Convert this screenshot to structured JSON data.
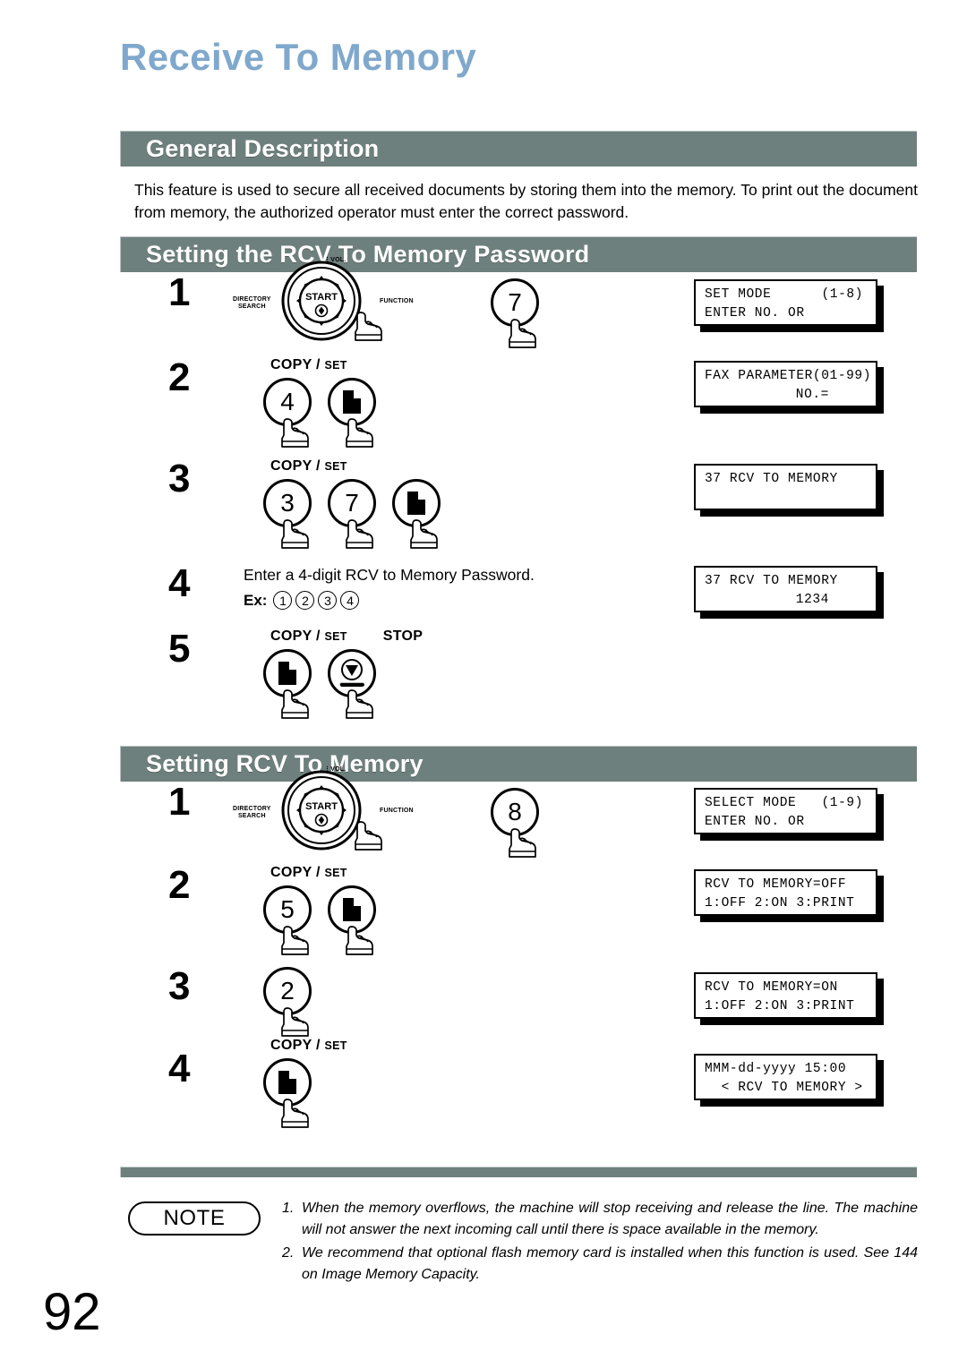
{
  "page": {
    "title": "Receive To Memory",
    "number": "92",
    "title_color": "#7fa8cc",
    "bar_color": "#6e807e"
  },
  "sections": {
    "general": {
      "heading": "General Description",
      "body": "This feature is used to secure all received documents by storing them into the memory.  To print out the document from memory, the authorized operator must enter the correct password."
    },
    "password": {
      "heading": "Setting the RCV To Memory Password",
      "steps": [
        {
          "num": "1",
          "type": "navwheel",
          "wheel": {
            "center": "START",
            "vol": "VOL.",
            "left": "DIRECTORY\nSEARCH",
            "right": "FUNCTION"
          },
          "keys": [
            {
              "label": "7",
              "glyph": "digit"
            }
          ],
          "lcd": {
            "line1": "SET MODE",
            "line1_right": "(1-8)",
            "line2": "ENTER NO. OR"
          }
        },
        {
          "num": "2",
          "type": "keys",
          "keylabel_main": "COPY /",
          "keylabel_sub": "SET",
          "keys": [
            {
              "label": "4",
              "glyph": "digit"
            },
            {
              "label": "",
              "glyph": "page"
            }
          ],
          "lcd": {
            "line1": "FAX PARAMETER(01-99)",
            "line2_right": "NO.="
          }
        },
        {
          "num": "3",
          "type": "keys",
          "keylabel_main": "COPY /",
          "keylabel_sub": "SET",
          "keys": [
            {
              "label": "3",
              "glyph": "digit"
            },
            {
              "label": "7",
              "glyph": "digit"
            },
            {
              "label": "",
              "glyph": "page"
            }
          ],
          "lcd": {
            "line1": "37 RCV TO MEMORY",
            "line2": ""
          }
        },
        {
          "num": "4",
          "type": "text",
          "text": "Enter a 4-digit RCV to Memory Password.",
          "example_label": "Ex:",
          "example_digits": [
            "1",
            "2",
            "3",
            "4"
          ],
          "lcd": {
            "line1": "37 RCV TO MEMORY",
            "line2_right": "1234"
          }
        },
        {
          "num": "5",
          "type": "keys",
          "keylabel_main": "COPY /",
          "keylabel_sub": "SET",
          "keylabel_second": "STOP",
          "keys": [
            {
              "label": "",
              "glyph": "page"
            },
            {
              "label": "",
              "glyph": "stop"
            }
          ],
          "lcd": null
        }
      ]
    },
    "setting": {
      "heading": "Setting RCV To Memory",
      "steps": [
        {
          "num": "1",
          "type": "navwheel",
          "wheel": {
            "center": "START",
            "vol": "VOL.",
            "left": "DIRECTORY\nSEARCH",
            "right": "FUNCTION"
          },
          "keys": [
            {
              "label": "8",
              "glyph": "digit"
            }
          ],
          "lcd": {
            "line1": "SELECT MODE",
            "line1_right": "(1-9)",
            "line2": "ENTER NO. OR"
          }
        },
        {
          "num": "2",
          "type": "keys",
          "keylabel_main": "COPY /",
          "keylabel_sub": "SET",
          "keys": [
            {
              "label": "5",
              "glyph": "digit"
            },
            {
              "label": "",
              "glyph": "page"
            }
          ],
          "lcd": {
            "line1": "RCV TO MEMORY=OFF",
            "line2": "1:OFF 2:ON 3:PRINT"
          }
        },
        {
          "num": "3",
          "type": "keys",
          "keylabel_main": "",
          "keylabel_sub": "",
          "keys": [
            {
              "label": "2",
              "glyph": "digit"
            }
          ],
          "lcd": {
            "line1": "RCV TO MEMORY=ON",
            "line2": "1:OFF 2:ON 3:PRINT"
          }
        },
        {
          "num": "4",
          "type": "keys",
          "keylabel_main": "COPY /",
          "keylabel_sub": "SET",
          "keys": [
            {
              "label": "",
              "glyph": "page"
            }
          ],
          "lcd": {
            "line1": "MMM-dd-yyyy 15:00",
            "line2": "  < RCV TO MEMORY >"
          }
        }
      ]
    }
  },
  "note": {
    "badge": "NOTE",
    "items": [
      {
        "n": "1.",
        "t": "When the memory overflows, the machine will stop receiving and release the line.  The machine will not answer the next incoming call until there is space available in the memory."
      },
      {
        "n": "2.",
        "t": "We recommend that optional flash memory card is installed when this function is used. See 144 on Image Memory Capacity."
      }
    ]
  }
}
